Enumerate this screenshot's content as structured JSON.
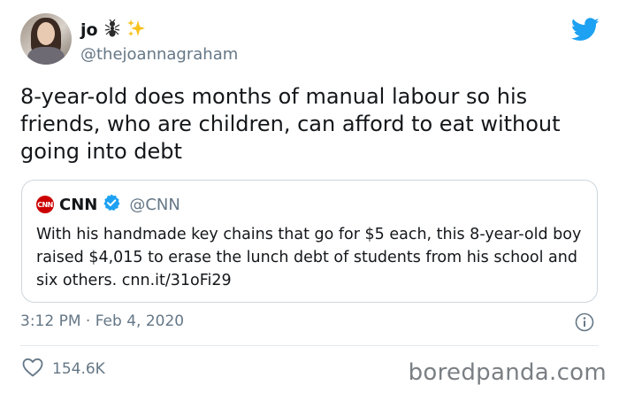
{
  "author": {
    "display_name": "jo",
    "handle": "@thejoannagraham",
    "name_emojis": [
      "ant-icon",
      "sparkles-icon"
    ]
  },
  "tweet": {
    "text": "8-year-old does months of manual labour so his friends, who are children, can afford to eat without going into debt",
    "timestamp": "3:12 PM · Feb 4, 2020",
    "likes": "154.6K"
  },
  "quoted_tweet": {
    "logo_text": "CNN",
    "display_name": "CNN",
    "handle": "@CNN",
    "verified": true,
    "text": "With his handmade key chains that go for $5 each, this 8-year-old boy raised $4,015 to erase the lunch debt of students from his school and six others. cnn.it/31oFi29"
  },
  "watermark": "boredpanda.com",
  "colors": {
    "twitter_blue": "#1da1f2",
    "cnn_red": "#cc0000",
    "secondary_text": "#657786"
  }
}
